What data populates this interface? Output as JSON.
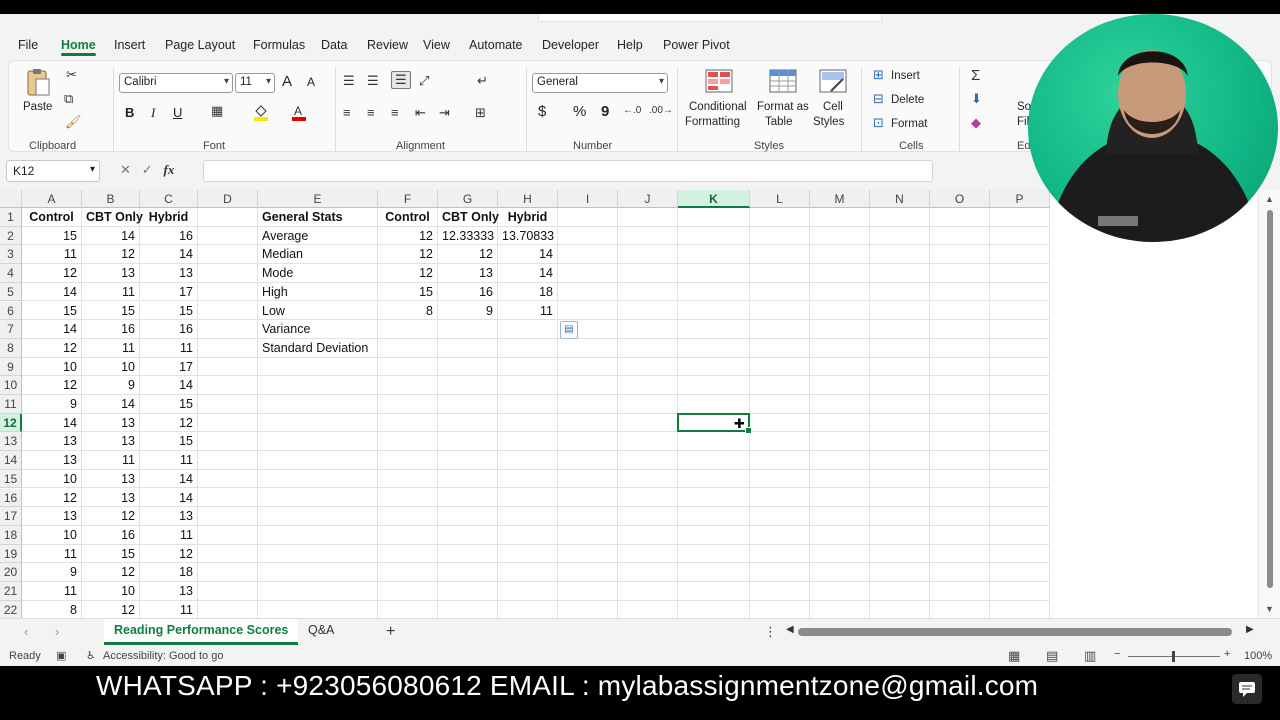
{
  "menu": {
    "tabs": [
      "File",
      "Home",
      "Insert",
      "Page Layout",
      "Formulas",
      "Data",
      "Review",
      "View",
      "Automate",
      "Developer",
      "Help",
      "Power Pivot"
    ],
    "active": "Home"
  },
  "ribbon": {
    "clipboard": {
      "paste": "Paste",
      "label": "Clipboard"
    },
    "font": {
      "family": "Calibri",
      "size": "11",
      "label": "Font",
      "bold": "B",
      "italic": "I",
      "underline": "U",
      "grow": "A",
      "shrink": "A"
    },
    "alignment": {
      "label": "Alignment"
    },
    "number": {
      "format": "General",
      "label": "Number",
      "currency": "$",
      "percent": "%",
      "comma": "9"
    },
    "styles": {
      "conditional_1": "Conditional",
      "conditional_2": "Formatting",
      "format_table_1": "Format as",
      "format_table_2": "Table",
      "cell_styles_1": "Cell",
      "cell_styles_2": "Styles",
      "label": "Styles"
    },
    "cells": {
      "insert": "Insert",
      "delete": "Delete",
      "format": "Format",
      "label": "Cells"
    },
    "editing": {
      "label": "Edi",
      "sort_1": "So",
      "sort_2": "Fil"
    }
  },
  "formula_bar": {
    "name_box": "K12",
    "fx": "fx",
    "value": ""
  },
  "grid": {
    "columns": [
      "A",
      "B",
      "C",
      "D",
      "E",
      "F",
      "G",
      "H",
      "I",
      "J",
      "K",
      "L",
      "M",
      "N",
      "O",
      "P"
    ],
    "selected_column": "K",
    "selected_row": 12,
    "rows": [
      1,
      2,
      3,
      4,
      5,
      6,
      7,
      8,
      9,
      10,
      11,
      12,
      13,
      14,
      15,
      16,
      17,
      18,
      19,
      20,
      21,
      22
    ],
    "data_headers": [
      "Control",
      "CBT Only",
      "Hybrid"
    ],
    "data": [
      [
        15,
        14,
        16
      ],
      [
        11,
        12,
        14
      ],
      [
        12,
        13,
        13
      ],
      [
        14,
        11,
        17
      ],
      [
        15,
        15,
        15
      ],
      [
        14,
        16,
        16
      ],
      [
        12,
        11,
        11
      ],
      [
        10,
        10,
        17
      ],
      [
        12,
        9,
        14
      ],
      [
        9,
        14,
        15
      ],
      [
        14,
        13,
        12
      ],
      [
        13,
        13,
        15
      ],
      [
        13,
        11,
        11
      ],
      [
        10,
        13,
        14
      ],
      [
        12,
        13,
        14
      ],
      [
        13,
        12,
        13
      ],
      [
        10,
        16,
        11
      ],
      [
        11,
        15,
        12
      ],
      [
        9,
        12,
        18
      ],
      [
        11,
        10,
        13
      ],
      [
        8,
        12,
        11
      ]
    ],
    "stats_header": "General Stats",
    "stats_cols": [
      "Control",
      "CBT Only",
      "Hybrid"
    ],
    "stats": [
      {
        "label": "Average",
        "values": [
          "12",
          "12.33333",
          "13.70833"
        ]
      },
      {
        "label": "Median",
        "values": [
          "12",
          "12",
          "14"
        ]
      },
      {
        "label": "Mode",
        "values": [
          "12",
          "13",
          "14"
        ]
      },
      {
        "label": "High",
        "values": [
          "15",
          "16",
          "18"
        ]
      },
      {
        "label": "Low",
        "values": [
          "8",
          "9",
          "11"
        ]
      },
      {
        "label": "Variance",
        "values": [
          "",
          "",
          ""
        ]
      },
      {
        "label": "Standard Deviation",
        "values": [
          "",
          "",
          ""
        ]
      }
    ]
  },
  "sheets": {
    "tabs": [
      "Reading Performance Scores",
      "Q&A"
    ],
    "active": "Reading Performance Scores",
    "add": "+"
  },
  "status": {
    "ready": "Ready",
    "accessibility": "Accessibility: Good to go",
    "zoom": "100%"
  },
  "banner": {
    "text": "WHATSAPP : +923056080612 EMAIL : mylabassignmentzone@gmail.com"
  },
  "colors": {
    "accent": "#107c41",
    "webcam_bg": "#12b887"
  }
}
